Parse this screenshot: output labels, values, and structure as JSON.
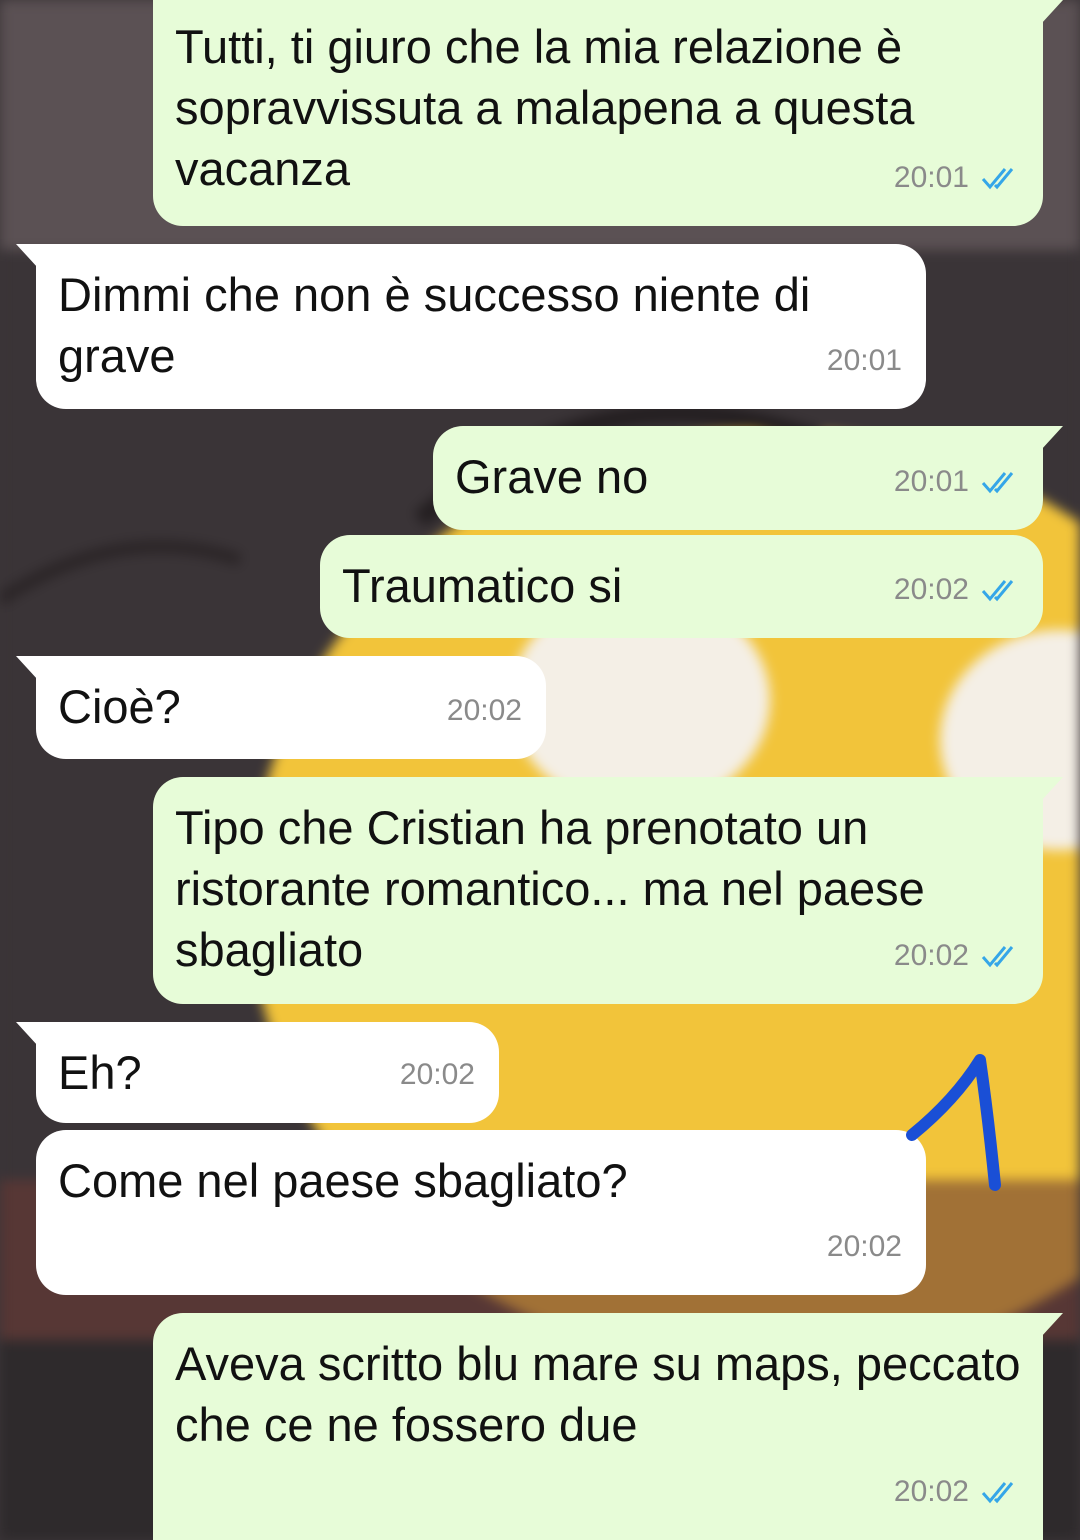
{
  "messages": [
    {
      "dir": "out",
      "text": "Tutti, ti giuro che la mia relazione è sopravvissuta a malapena a questa vacanza",
      "time": "20:01"
    },
    {
      "dir": "in",
      "text": "Dimmi che non è successo niente di grave",
      "time": "20:01"
    },
    {
      "dir": "out",
      "text": "Grave no",
      "time": "20:01"
    },
    {
      "dir": "out",
      "text": "Traumatico si",
      "time": "20:02"
    },
    {
      "dir": "in",
      "text": "Cioè?",
      "time": "20:02"
    },
    {
      "dir": "out",
      "text": "Tipo che Cristian ha prenotato un ristorante romantico... ma nel paese sbagliato",
      "time": "20:02"
    },
    {
      "dir": "in",
      "text": "Eh?",
      "time": "20:02"
    },
    {
      "dir": "in",
      "text": "Come nel paese sbagliato?",
      "time": "20:02"
    },
    {
      "dir": "out",
      "text": "Aveva scritto blu mare su maps, peccato che ce ne fossero due",
      "time": "20:02"
    }
  ],
  "colors": {
    "outgoing_bubble": "#e7fcd8",
    "incoming_bubble": "#ffffff",
    "read_ticks": "#35a6e8",
    "annotation_mark": "#1a4fd6"
  },
  "icons": {
    "read_receipt": "double-check-icon",
    "annotation": "hand-drawn-arrow-icon"
  }
}
